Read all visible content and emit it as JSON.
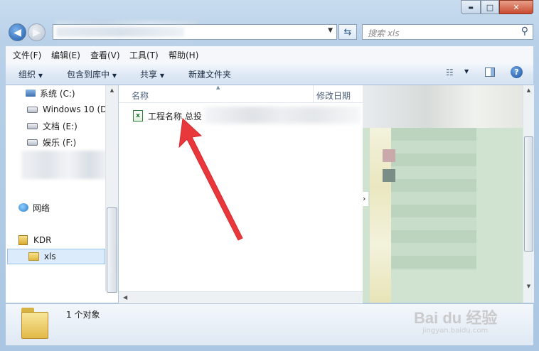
{
  "window": {
    "controls": {
      "minimize": "▬",
      "maximize": "□",
      "close": "✕"
    }
  },
  "address": {
    "back_icon": "back-arrow-icon",
    "forward_icon": "forward-arrow-icon",
    "dropdown_icon": "chevron-down-icon",
    "refresh_icon": "refresh-icon"
  },
  "search": {
    "placeholder": "搜索 xls"
  },
  "menu": [
    "文件(F)",
    "编辑(E)",
    "查看(V)",
    "工具(T)",
    "帮助(H)"
  ],
  "toolbar": {
    "organize": "组织",
    "include_in_library": "包含到库中",
    "share": "共享",
    "new_folder": "新建文件夹"
  },
  "nav": {
    "drives": [
      "系统 (C:)",
      "Windows 10 (D",
      "文档 (E:)",
      "娱乐 (F:)"
    ],
    "network": "网络",
    "kdr": "KDR",
    "xls": "xls"
  },
  "columns": {
    "name": "名称",
    "modified": "修改日期"
  },
  "files": [
    {
      "name": "工程名称 总投"
    }
  ],
  "status": {
    "count": "1 个对象"
  },
  "watermark": {
    "brand": "Bai du 经验",
    "url": "jingyan.baidu.com"
  },
  "colors": {
    "arrow": "#e8383b",
    "accent": "#2b6cb0"
  }
}
